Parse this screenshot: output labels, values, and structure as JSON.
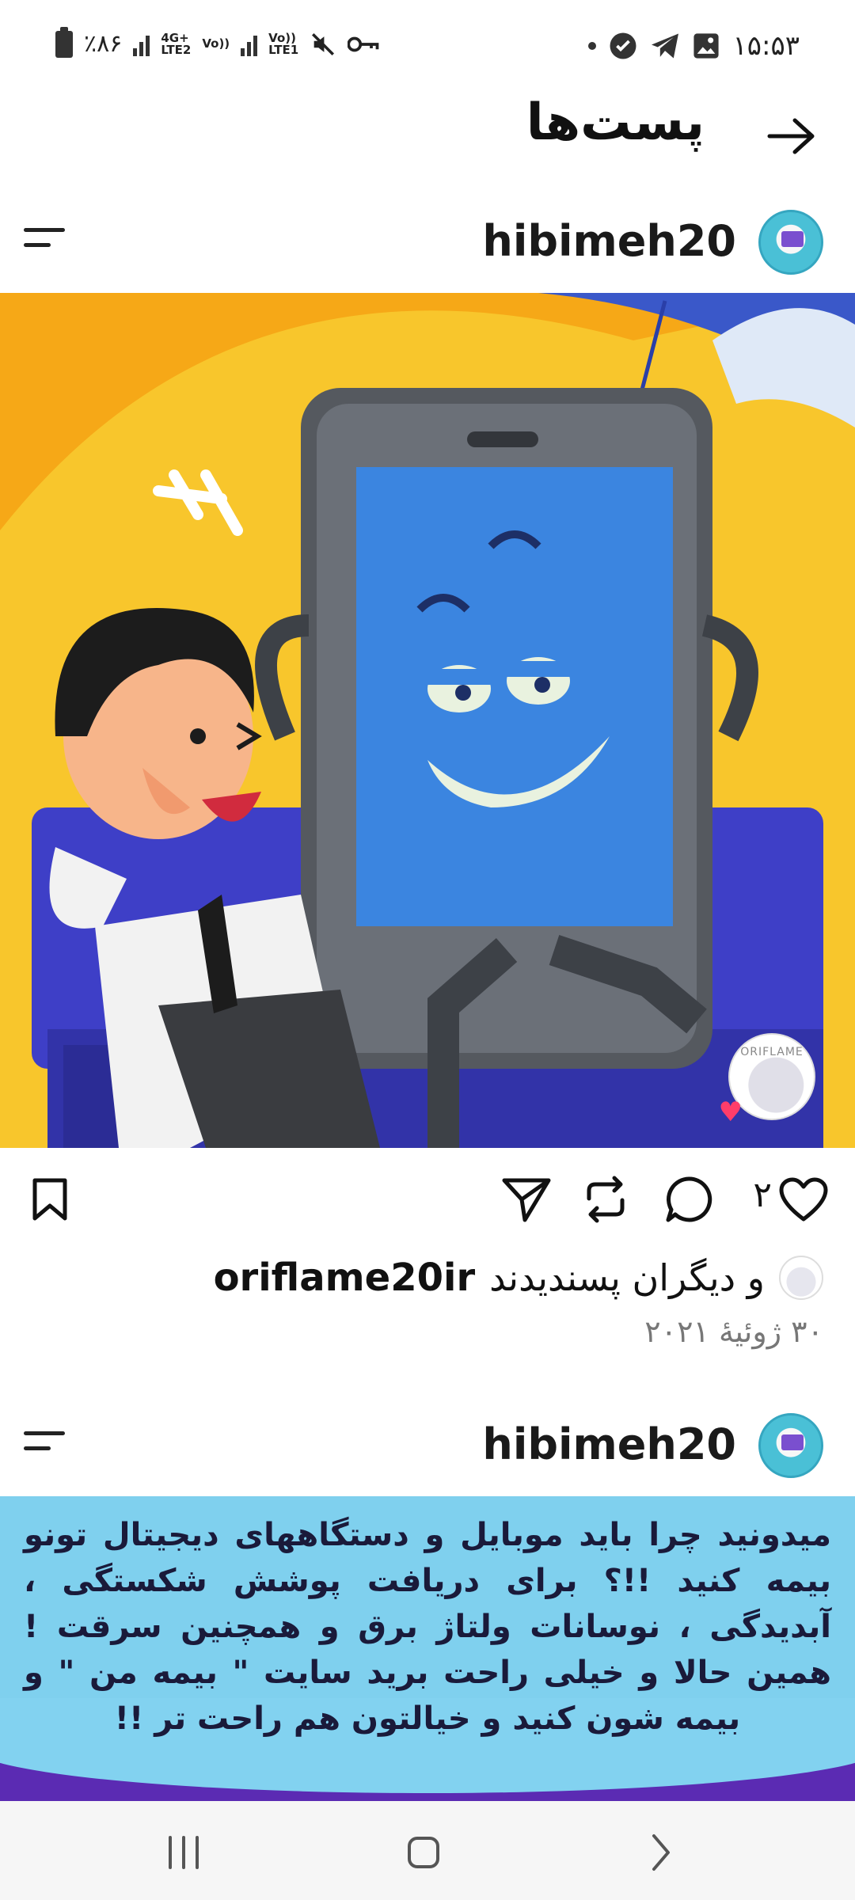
{
  "status_bar": {
    "time": "۱۵:۵۳",
    "battery": "٪۸۶",
    "network1": [
      "4G+",
      "Vo))",
      "LTE2"
    ],
    "network2": [
      "Vo))",
      "LTE1"
    ]
  },
  "header": {
    "title": "پست‌ها"
  },
  "posts": [
    {
      "username": "hibimeh20",
      "badge_text": "ORIFLAME",
      "like_count": "۲",
      "liked_by": "oriflame20ir",
      "liked_suffix": "و دیگران پسندیدند",
      "date": "۳۰ ژوئیهٔ ۲۰۲۱"
    },
    {
      "username": "hibimeh20",
      "image_text": "میدونید چرا باید موبایل و دستگاههای دیجیتال تونو بیمه کنید !!؟ برای دریافت پوشش شکستگی ، آبدیدگی ، نوسانات ولتاژ برق و همچنین سرقت ! همین حالا و خیلی راحت برید سایت \" بیمه من \" و بیمه شون کنید و خیالتون هم راحت تر !!"
    }
  ],
  "colors": {
    "accent": "#111111",
    "date": "#777777",
    "post1_bg_yellow": "#f6a817",
    "post1_phone_screen": "#3b85e0",
    "post2_bg": "#7fd0ee"
  }
}
